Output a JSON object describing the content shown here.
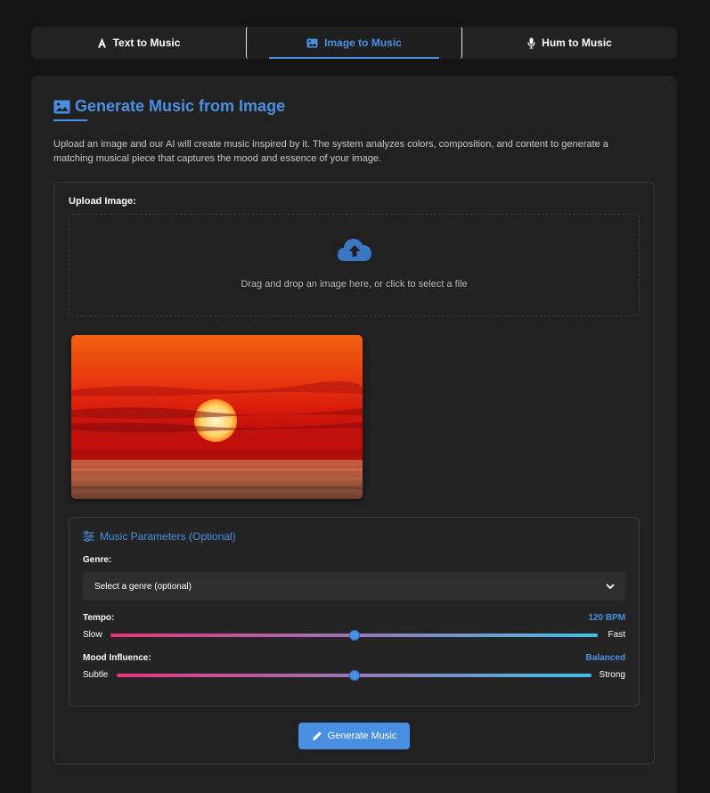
{
  "tabs": [
    {
      "label": "Text to Music",
      "icon": "font-icon",
      "active": false
    },
    {
      "label": "Image to Music",
      "icon": "image-icon",
      "active": true
    },
    {
      "label": "Hum to Music",
      "icon": "microphone-icon",
      "active": false
    }
  ],
  "page": {
    "title": "Generate Music from Image",
    "description": "Upload an image and our AI will create music inspired by it. The system analyzes colors, composition, and content to generate a matching musical piece that captures the mood and essence of your image."
  },
  "upload": {
    "label": "Upload Image:",
    "dropzone_text": "Drag and drop an image here, or click to select a file",
    "icon": "cloud-upload-icon"
  },
  "preview": {
    "subject": "sunset over sea"
  },
  "params": {
    "title": "Music Parameters (Optional)",
    "icon": "sliders-icon",
    "genre": {
      "label": "Genre:",
      "selected": "Select a genre (optional)"
    },
    "tempo": {
      "label": "Tempo:",
      "value_text": "120 BPM",
      "min_label": "Slow",
      "max_label": "Fast",
      "level": 0.5
    },
    "mood": {
      "label": "Mood Influence:",
      "value_text": "Balanced",
      "min_label": "Subtle",
      "max_label": "Strong",
      "level": 0.5
    }
  },
  "generate_button": {
    "label": "Generate Music",
    "icon": "pencil-icon"
  },
  "colors": {
    "accent": "#4a90e2",
    "background": "#141414",
    "panel": "#212121"
  }
}
